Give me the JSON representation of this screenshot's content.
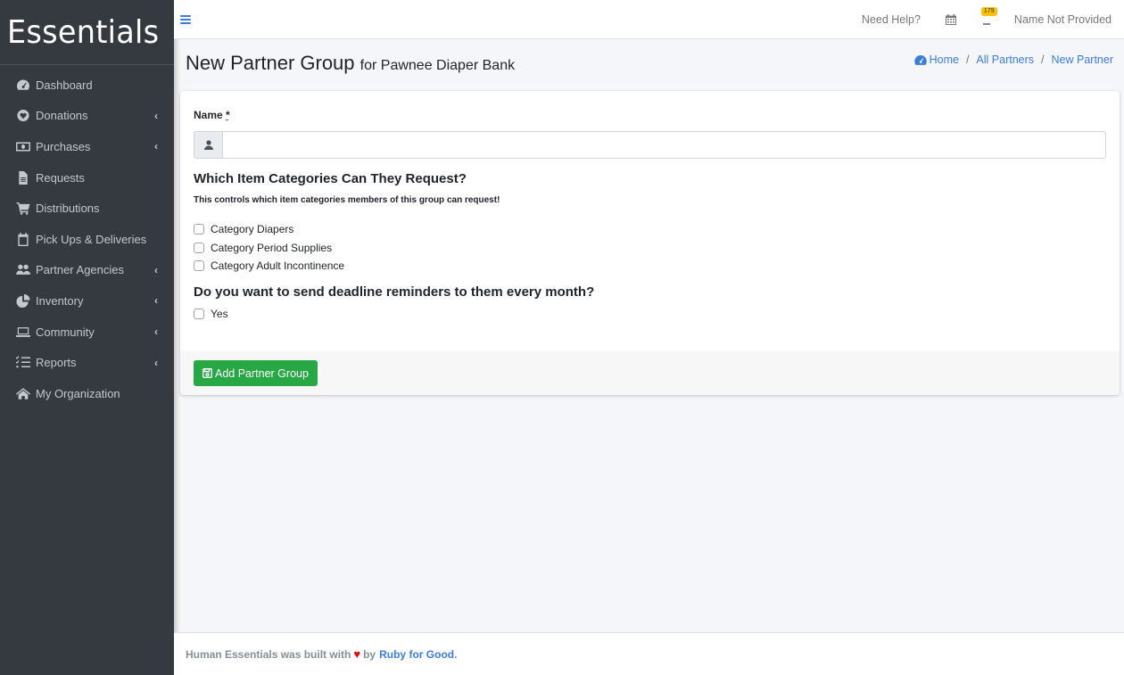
{
  "sidebar": {
    "brand": "Essentials",
    "items": [
      {
        "label": "Dashboard",
        "icon": "dashboard-icon",
        "has_submenu": false
      },
      {
        "label": "Donations",
        "icon": "heart-circle-icon",
        "has_submenu": true
      },
      {
        "label": "Purchases",
        "icon": "money-bill-icon",
        "has_submenu": true
      },
      {
        "label": "Requests",
        "icon": "file-icon",
        "has_submenu": false
      },
      {
        "label": "Distributions",
        "icon": "shopping-cart-icon",
        "has_submenu": false
      },
      {
        "label": "Pick Ups & Deliveries",
        "icon": "calendar-icon",
        "has_submenu": false
      },
      {
        "label": "Partner Agencies",
        "icon": "users-icon",
        "has_submenu": true
      },
      {
        "label": "Inventory",
        "icon": "pie-chart-icon",
        "has_submenu": true
      },
      {
        "label": "Community",
        "icon": "laptop-icon",
        "has_submenu": true
      },
      {
        "label": "Reports",
        "icon": "tasks-icon",
        "has_submenu": true
      },
      {
        "label": "My Organization",
        "icon": "home-icon",
        "has_submenu": false
      }
    ],
    "chevron": "‹"
  },
  "topbar": {
    "help": "Need Help?",
    "notifications_count": "179",
    "user_name": "Name Not Provided"
  },
  "header": {
    "title": "New Partner Group",
    "subtitle": "for Pawnee Diaper Bank",
    "breadcrumb": [
      "Home",
      "All Partners",
      "New Partner"
    ]
  },
  "form": {
    "name_label": "Name",
    "required_mark": "*",
    "name_value": "",
    "categories_title": "Which Item Categories Can They Request?",
    "categories_help": "This controls which item categories members of this group can request!",
    "categories": [
      {
        "label": "Category Diapers",
        "checked": false
      },
      {
        "label": "Category Period Supplies",
        "checked": false
      },
      {
        "label": "Category Adult Incontinence",
        "checked": false
      }
    ],
    "reminders_title": "Do you want to send deadline reminders to them every month?",
    "reminders_option": {
      "label": "Yes",
      "checked": false
    },
    "submit_label": "Add Partner Group"
  },
  "footer": {
    "text_before": "Human Essentials was built with",
    "heart": "♥",
    "text_by": "by",
    "link": "Ruby for Good",
    "period": "."
  },
  "colors": {
    "sidebar_bg": "#343a40",
    "accent": "#3b7ddd",
    "success": "#28a745",
    "badge": "#ffc107",
    "heart": "#e3000f"
  }
}
